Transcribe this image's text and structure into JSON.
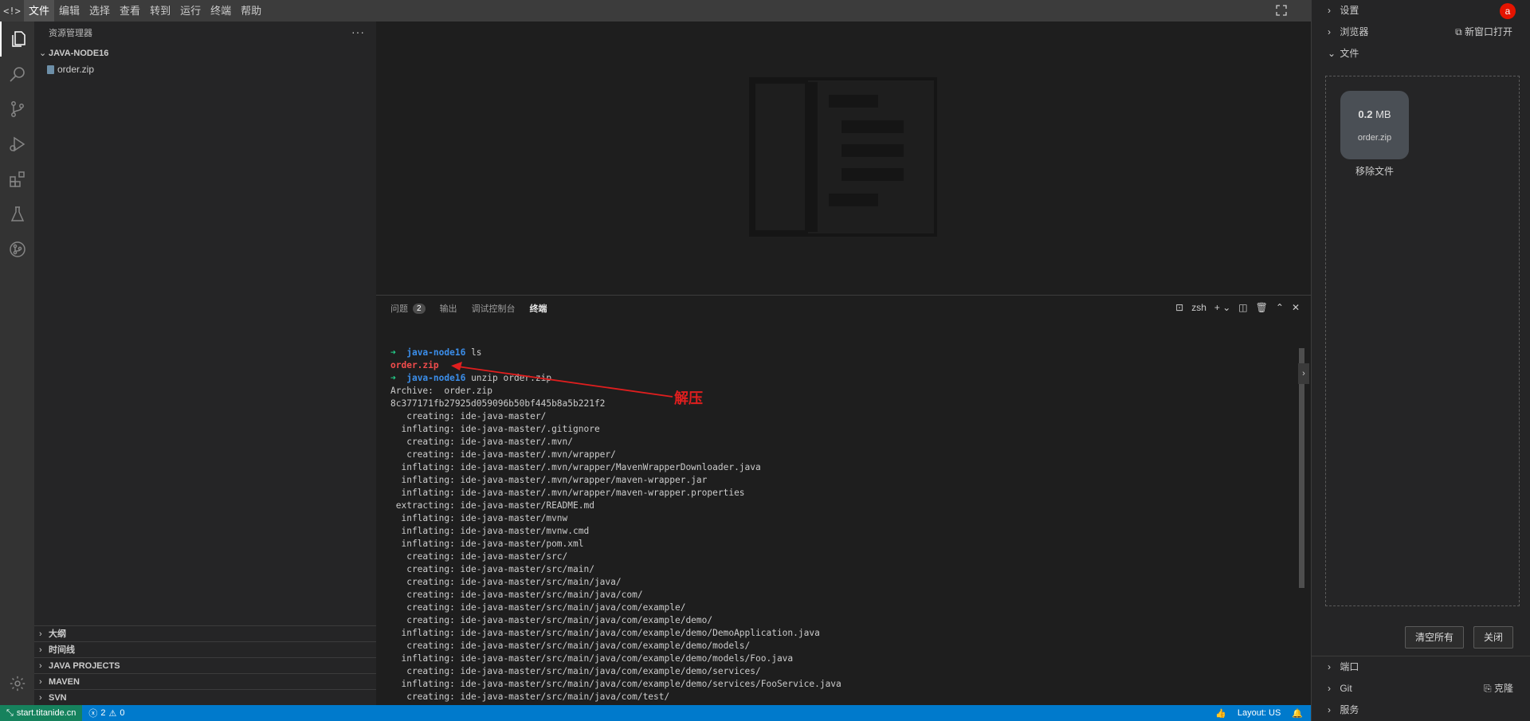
{
  "menubar": {
    "logo": "<!>",
    "items": [
      "文件",
      "编辑",
      "选择",
      "查看",
      "转到",
      "运行",
      "终端",
      "帮助"
    ]
  },
  "activity_icons": [
    "files-icon",
    "search-icon",
    "source-control-icon",
    "run-debug-icon",
    "extensions-icon",
    "testing-icon",
    "git-graph-icon"
  ],
  "sidebar": {
    "title": "资源管理器",
    "more": "···",
    "project": "JAVA-NODE16",
    "files": [
      "order.zip"
    ],
    "bottom_sections": [
      "大纲",
      "时间线",
      "JAVA PROJECTS",
      "MAVEN",
      "SVN"
    ]
  },
  "panel": {
    "tabs": [
      {
        "label": "问题",
        "badge": "2"
      },
      {
        "label": "输出"
      },
      {
        "label": "调试控制台"
      },
      {
        "label": "终端"
      }
    ],
    "shell": "zsh",
    "terminal_lines": [
      {
        "kind": "prompt",
        "dir": "java-node16",
        "cmd": "ls"
      },
      {
        "kind": "red",
        "text": "order.zip"
      },
      {
        "kind": "prompt",
        "dir": "java-node16",
        "cmd": "unzip order.zip"
      },
      {
        "kind": "out",
        "text": "Archive:  order.zip"
      },
      {
        "kind": "out",
        "text": "8c377171fb27925d059096b50bf445b8a5b221f2"
      },
      {
        "kind": "out",
        "text": "   creating: ide-java-master/"
      },
      {
        "kind": "out",
        "text": "  inflating: ide-java-master/.gitignore"
      },
      {
        "kind": "out",
        "text": "   creating: ide-java-master/.mvn/"
      },
      {
        "kind": "out",
        "text": "   creating: ide-java-master/.mvn/wrapper/"
      },
      {
        "kind": "out",
        "text": "  inflating: ide-java-master/.mvn/wrapper/MavenWrapperDownloader.java"
      },
      {
        "kind": "out",
        "text": "  inflating: ide-java-master/.mvn/wrapper/maven-wrapper.jar"
      },
      {
        "kind": "out",
        "text": "  inflating: ide-java-master/.mvn/wrapper/maven-wrapper.properties"
      },
      {
        "kind": "out",
        "text": " extracting: ide-java-master/README.md"
      },
      {
        "kind": "out",
        "text": "  inflating: ide-java-master/mvnw"
      },
      {
        "kind": "out",
        "text": "  inflating: ide-java-master/mvnw.cmd"
      },
      {
        "kind": "out",
        "text": "  inflating: ide-java-master/pom.xml"
      },
      {
        "kind": "out",
        "text": "   creating: ide-java-master/src/"
      },
      {
        "kind": "out",
        "text": "   creating: ide-java-master/src/main/"
      },
      {
        "kind": "out",
        "text": "   creating: ide-java-master/src/main/java/"
      },
      {
        "kind": "out",
        "text": "   creating: ide-java-master/src/main/java/com/"
      },
      {
        "kind": "out",
        "text": "   creating: ide-java-master/src/main/java/com/example/"
      },
      {
        "kind": "out",
        "text": "   creating: ide-java-master/src/main/java/com/example/demo/"
      },
      {
        "kind": "out",
        "text": "  inflating: ide-java-master/src/main/java/com/example/demo/DemoApplication.java"
      },
      {
        "kind": "out",
        "text": "   creating: ide-java-master/src/main/java/com/example/demo/models/"
      },
      {
        "kind": "out",
        "text": "  inflating: ide-java-master/src/main/java/com/example/demo/models/Foo.java"
      },
      {
        "kind": "out",
        "text": "   creating: ide-java-master/src/main/java/com/example/demo/services/"
      },
      {
        "kind": "out",
        "text": "  inflating: ide-java-master/src/main/java/com/example/demo/services/FooService.java"
      },
      {
        "kind": "out",
        "text": "   creating: ide-java-master/src/main/java/com/test/"
      }
    ],
    "annotation": "解压",
    "annotation_color": "#e01e1e"
  },
  "rightpanel": {
    "settings": "设置",
    "avatar": "a",
    "browser": "浏览器",
    "open_new_window": "新窗口打开",
    "files": "文件",
    "file_card": {
      "size_value": "0.2",
      "size_unit": "MB",
      "name": "order.zip"
    },
    "remove_file": "移除文件",
    "clear_all": "清空所有",
    "close": "关闭",
    "port": "端口",
    "git": "Git",
    "clone": "克隆",
    "services": "服务"
  },
  "statusbar": {
    "remote": "start.titanide.cn",
    "errors": "2",
    "warnings": "0",
    "layout": "Layout: US"
  },
  "colors": {
    "statusbar": "#007acc",
    "remote": "#16825d",
    "prompt_arrow": "#23d18b",
    "prompt_dir": "#3b8eea",
    "red_text": "#f14c4c"
  }
}
